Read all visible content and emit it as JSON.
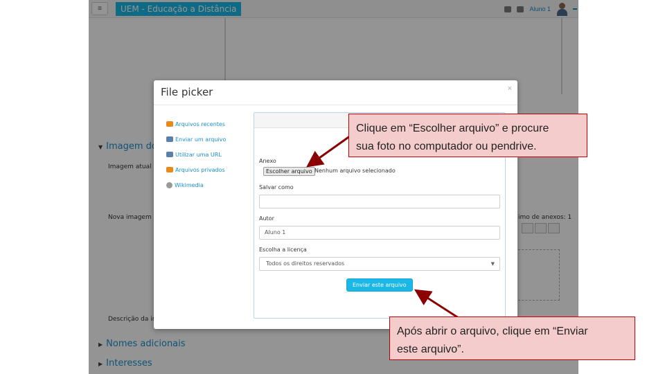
{
  "navbar": {
    "menu_icon": "hamburger-icon",
    "site_name": "UEM - Educação a Distância",
    "user_name": "Aluno 1"
  },
  "background": {
    "section_image": "Imagem do",
    "current_image_label": "Imagem atual",
    "new_image_label": "Nova imagem",
    "max_attachments": "imo de anexos: 1",
    "description_label": "Descrição da ima",
    "section_names": "Nomes adicionais",
    "section_interests": "Interesses"
  },
  "modal": {
    "title": "File picker",
    "close": "×",
    "repositories": [
      {
        "label": "Arquivos recentes",
        "icon": "recent-files-icon"
      },
      {
        "label": "Enviar um arquivo",
        "icon": "upload-icon"
      },
      {
        "label": "Utilizar uma URL",
        "icon": "url-icon"
      },
      {
        "label": "Arquivos privados",
        "icon": "private-files-icon"
      },
      {
        "label": "Wikimedia",
        "icon": "wikimedia-icon"
      }
    ],
    "form": {
      "attachment_label": "Anexo",
      "choose_file_button": "Escolher arquivo",
      "no_file_text": "Nenhum arquivo selecionado",
      "save_as_label": "Salvar como",
      "save_as_value": "",
      "author_label": "Autor",
      "author_value": "Aluno 1",
      "license_label": "Escolha a licença",
      "license_value": "Todos os direitos reservados",
      "submit_button": "Enviar este arquivo"
    }
  },
  "callouts": {
    "choose_file_line1": "Clique em “Escolher arquivo” e procure",
    "choose_file_line2": "sua foto no computador ou pendrive.",
    "send_file_line1": "Após abrir o arquivo, clique em “Enviar",
    "send_file_line2": "este arquivo”.",
    "color": "#c00000",
    "background": "#f4cccc"
  }
}
